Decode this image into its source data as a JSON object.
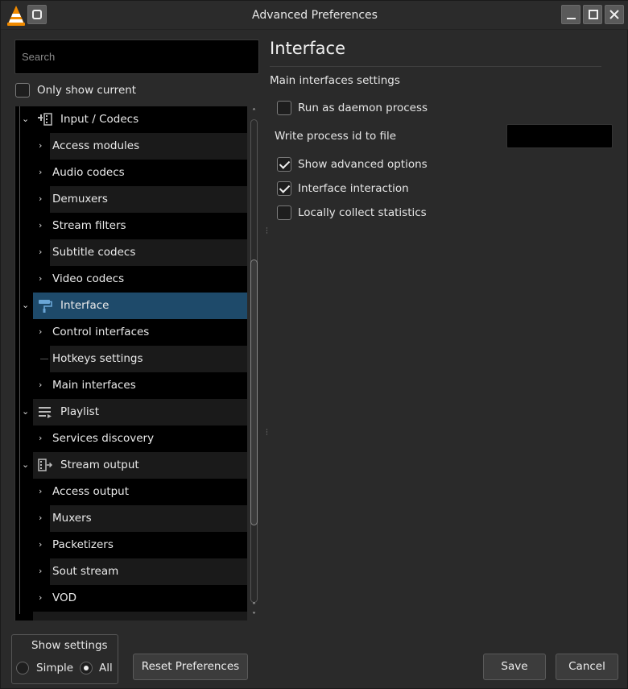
{
  "window": {
    "title": "Advanced Preferences"
  },
  "search": {
    "placeholder": "Search"
  },
  "only_show_current": {
    "label": "Only show current",
    "checked": false
  },
  "tree": [
    {
      "label": "Input / Codecs",
      "level": 0,
      "expanded": true,
      "icon": "codec-icon"
    },
    {
      "label": "Access modules",
      "level": 1,
      "has_children": true
    },
    {
      "label": "Audio codecs",
      "level": 1,
      "has_children": true
    },
    {
      "label": "Demuxers",
      "level": 1,
      "has_children": true
    },
    {
      "label": "Stream filters",
      "level": 1,
      "has_children": true
    },
    {
      "label": "Subtitle codecs",
      "level": 1,
      "has_children": true
    },
    {
      "label": "Video codecs",
      "level": 1,
      "has_children": true
    },
    {
      "label": "Interface",
      "level": 0,
      "expanded": true,
      "selected": true,
      "icon": "paint-roller-icon"
    },
    {
      "label": "Control interfaces",
      "level": 1,
      "has_children": true
    },
    {
      "label": "Hotkeys settings",
      "level": 1,
      "has_children": false
    },
    {
      "label": "Main interfaces",
      "level": 1,
      "has_children": true
    },
    {
      "label": "Playlist",
      "level": 0,
      "expanded": true,
      "icon": "playlist-icon"
    },
    {
      "label": "Services discovery",
      "level": 1,
      "has_children": true
    },
    {
      "label": "Stream output",
      "level": 0,
      "expanded": true,
      "icon": "stream-output-icon"
    },
    {
      "label": "Access output",
      "level": 1,
      "has_children": true
    },
    {
      "label": "Muxers",
      "level": 1,
      "has_children": true
    },
    {
      "label": "Packetizers",
      "level": 1,
      "has_children": true
    },
    {
      "label": "Sout stream",
      "level": 1,
      "has_children": true
    },
    {
      "label": "VOD",
      "level": 1,
      "has_children": true
    }
  ],
  "panel": {
    "title": "Interface",
    "section": "Main interfaces settings",
    "options": [
      {
        "label": "Run as daemon process",
        "checked": false
      },
      {
        "label": "Show advanced options",
        "checked": true
      },
      {
        "label": "Interface interaction",
        "checked": true
      },
      {
        "label": "Locally collect statistics",
        "checked": false
      }
    ],
    "pid_label": "Write process id to file",
    "pid_value": ""
  },
  "show_settings": {
    "legend": "Show settings",
    "simple": "Simple",
    "all": "All",
    "selected": "All"
  },
  "buttons": {
    "reset": "Reset Preferences",
    "save": "Save",
    "cancel": "Cancel"
  },
  "colors": {
    "selection": "#1e4a6a",
    "vlc_orange": "#f08a00"
  }
}
